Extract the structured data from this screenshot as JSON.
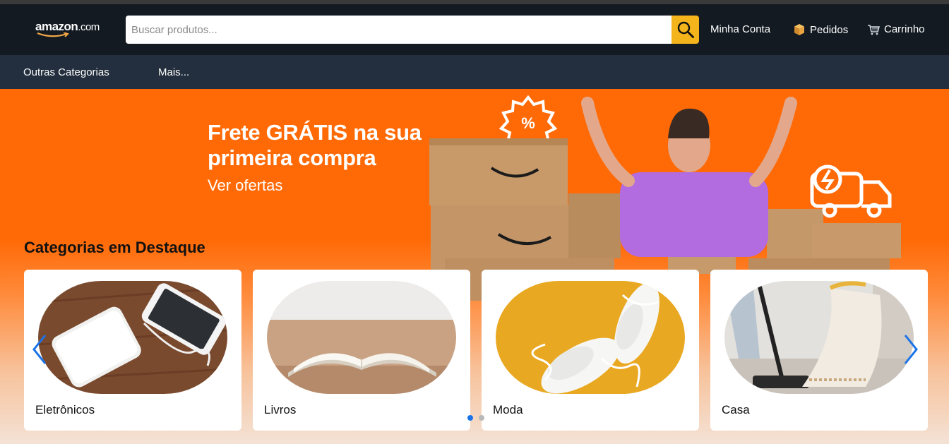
{
  "header": {
    "logo_text": "amazon",
    "logo_suffix": ".com",
    "search": {
      "placeholder": "Buscar produtos...",
      "value": ""
    },
    "links": [
      {
        "label": "Minha Conta",
        "icon": "user-icon"
      },
      {
        "label": "Pedidos",
        "icon": "package-icon"
      },
      {
        "label": "Carrinho",
        "icon": "cart-icon"
      }
    ]
  },
  "subnav": {
    "items": [
      "Outras Categorias",
      "Mais..."
    ]
  },
  "hero": {
    "title_line1": "Frete GRÁTIS na sua",
    "title_line2": "primeira compra",
    "cta": "Ver ofertas"
  },
  "featured": {
    "title": "Categorias em Destaque",
    "categories": [
      {
        "label": "Eletrônicos",
        "icon": "powerbank-phone-image"
      },
      {
        "label": "Livros",
        "icon": "open-book-image"
      },
      {
        "label": "Moda",
        "icon": "sneakers-image"
      },
      {
        "label": "Casa",
        "icon": "vacuum-rug-image"
      }
    ],
    "carousel": {
      "active_dot": 1,
      "dots": 2
    }
  },
  "colors": {
    "header_bg": "#131a22",
    "subnav_bg": "#232f3e",
    "search_button": "#f3b51b",
    "hero_orange": "#ff6a07",
    "arrow_blue": "#1a73e8"
  }
}
